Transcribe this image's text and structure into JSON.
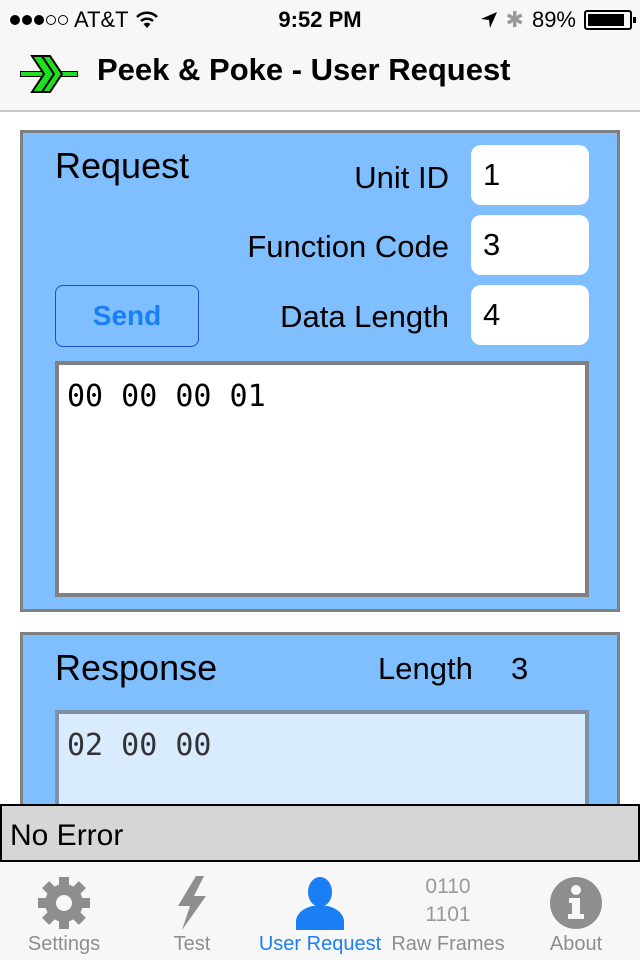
{
  "status_bar": {
    "carrier": "AT&T",
    "signal_bars": 3,
    "signal_total": 5,
    "time": "9:52 PM",
    "battery_percent": "89%",
    "battery_level": 0.89
  },
  "nav": {
    "title": "Peek & Poke - User Request",
    "logo_icon": "green-double-arrow-icon"
  },
  "request": {
    "title": "Request",
    "unit_id_label": "Unit ID",
    "unit_id_value": "1",
    "function_code_label": "Function Code",
    "function_code_value": "3",
    "data_length_label": "Data Length",
    "data_length_value": "4",
    "send_label": "Send",
    "data": "00 00 00 01"
  },
  "response": {
    "title": "Response",
    "length_label": "Length",
    "length_value": "3",
    "data": "02 00 00"
  },
  "status_message": "No Error",
  "tabs": [
    {
      "label": "Settings",
      "icon": "gear-icon",
      "active": false
    },
    {
      "label": "Test",
      "icon": "lightning-icon",
      "active": false
    },
    {
      "label": "User Request",
      "icon": "user-icon",
      "active": true
    },
    {
      "label": "Raw Frames",
      "icon": "binary-icon",
      "icon_text": [
        "0110",
        "1101"
      ],
      "active": false
    },
    {
      "label": "About",
      "icon": "info-icon",
      "active": false
    }
  ],
  "colors": {
    "panel_bg": "#80bfff",
    "accent": "#1a7ef5",
    "logo_green": "#1ee01e"
  }
}
